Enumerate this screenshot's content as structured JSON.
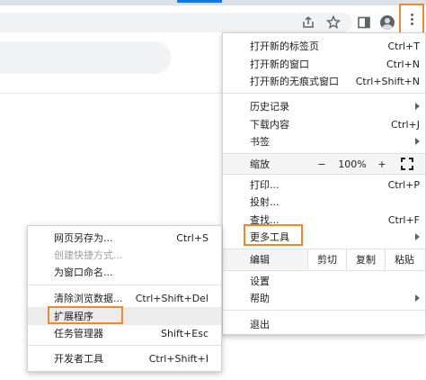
{
  "main_menu": {
    "group1": [
      {
        "label": "打开新的标签页",
        "shortcut": "Ctrl+T"
      },
      {
        "label": "打开新的窗口",
        "shortcut": "Ctrl+N"
      },
      {
        "label": "打开新的无痕式窗口",
        "shortcut": "Ctrl+Shift+N"
      }
    ],
    "group2": [
      {
        "label": "历史记录",
        "shortcut": ""
      },
      {
        "label": "下载内容",
        "shortcut": "Ctrl+J"
      },
      {
        "label": "书签",
        "shortcut": ""
      }
    ],
    "zoom": {
      "label": "缩放",
      "minus": "−",
      "value": "100%",
      "plus": "+"
    },
    "group3": [
      {
        "label": "打印...",
        "shortcut": "Ctrl+P"
      },
      {
        "label": "投射...",
        "shortcut": ""
      },
      {
        "label": "查找...",
        "shortcut": "Ctrl+F"
      },
      {
        "label": "更多工具",
        "shortcut": ""
      }
    ],
    "edit": {
      "label": "编辑",
      "cut": "剪切",
      "copy": "复制",
      "paste": "粘贴"
    },
    "group4": [
      {
        "label": "设置",
        "shortcut": ""
      },
      {
        "label": "帮助",
        "shortcut": ""
      }
    ],
    "exit": {
      "label": "退出"
    }
  },
  "sub_menu": {
    "group1": [
      {
        "label": "网页另存为...",
        "shortcut": "Ctrl+S"
      },
      {
        "label": "创建快捷方式...",
        "shortcut": ""
      },
      {
        "label": "为窗口命名...",
        "shortcut": ""
      }
    ],
    "group2": [
      {
        "label": "清除浏览数据...",
        "shortcut": "Ctrl+Shift+Del"
      },
      {
        "label": "扩展程序",
        "shortcut": ""
      },
      {
        "label": "任务管理器",
        "shortcut": "Shift+Esc"
      }
    ],
    "group3": [
      {
        "label": "开发者工具",
        "shortcut": "Ctrl+Shift+I"
      }
    ]
  },
  "colors": {
    "highlight": "#e98a2e",
    "accent": "#1a73e8",
    "icon": "#5f6368"
  },
  "icons": [
    "share-icon",
    "bookmark-star-icon",
    "side-panel-icon",
    "profile-avatar-icon",
    "kebab-menu-icon",
    "fullscreen-icon",
    "submenu-arrow-icon"
  ]
}
